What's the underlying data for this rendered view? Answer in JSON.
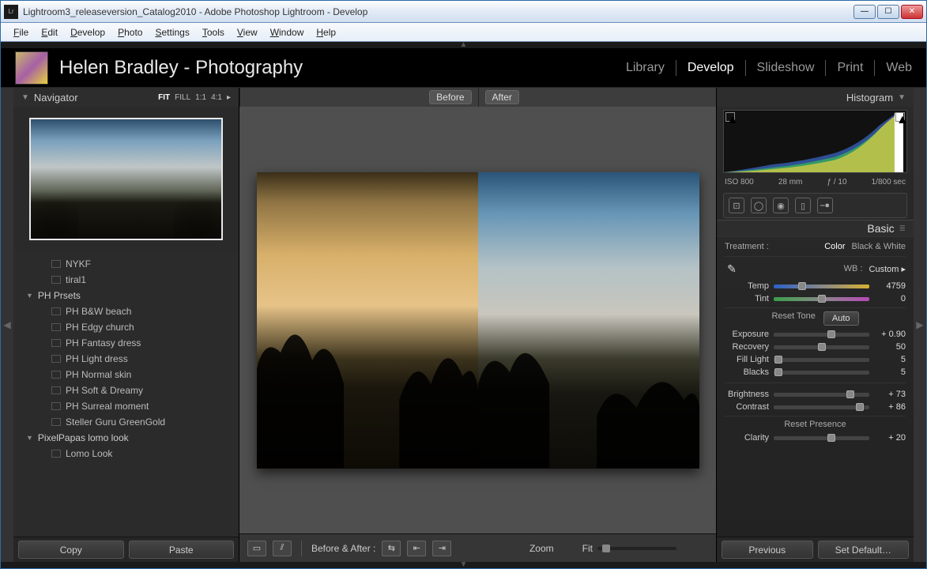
{
  "window": {
    "title": "Lightroom3_releaseversion_Catalog2010 - Adobe Photoshop Lightroom - Develop",
    "app_icon_label": "Lr"
  },
  "menu": [
    "File",
    "Edit",
    "Develop",
    "Photo",
    "Settings",
    "Tools",
    "View",
    "Window",
    "Help"
  ],
  "identity": {
    "name": "Helen Bradley - Photography"
  },
  "modules": [
    "Library",
    "Develop",
    "Slideshow",
    "Print",
    "Web"
  ],
  "active_module": "Develop",
  "navigator": {
    "title": "Navigator",
    "zooms": [
      "FIT",
      "FILL",
      "1:1",
      "4:1"
    ],
    "active_zoom": "FIT"
  },
  "presets": {
    "loose_items": [
      "NYKF",
      "tiral1"
    ],
    "folders": [
      {
        "name": "PH Prsets",
        "items": [
          "PH B&W beach",
          "PH Edgy church",
          "PH Fantasy dress",
          "PH Light dress",
          "PH Normal skin",
          "PH Soft & Dreamy",
          "PH Surreal moment",
          "Steller Guru GreenGold"
        ]
      },
      {
        "name": "PixelPapas lomo look",
        "items": [
          "Lomo Look"
        ]
      }
    ]
  },
  "left_buttons": {
    "copy": "Copy",
    "paste": "Paste"
  },
  "compare": {
    "before": "Before",
    "after": "After"
  },
  "center_footer": {
    "before_after": "Before & After :",
    "zoom": "Zoom",
    "fit": "Fit"
  },
  "histogram": {
    "title": "Histogram",
    "iso": "ISO 800",
    "focal": "28 mm",
    "aperture": "ƒ / 10",
    "shutter": "1/800 sec"
  },
  "basic": {
    "title": "Basic",
    "treatment_label": "Treatment :",
    "color": "Color",
    "bw": "Black & White",
    "wb_label": "WB :",
    "wb_value": "Custom",
    "temp_label": "Temp",
    "temp_value": "4759",
    "tint_label": "Tint",
    "tint_value": "0",
    "reset_tone": "Reset Tone",
    "auto": "Auto",
    "exposure_label": "Exposure",
    "exposure_value": "+ 0.90",
    "recovery_label": "Recovery",
    "recovery_value": "50",
    "fill_label": "Fill Light",
    "fill_value": "5",
    "blacks_label": "Blacks",
    "blacks_value": "5",
    "brightness_label": "Brightness",
    "brightness_value": "+ 73",
    "contrast_label": "Contrast",
    "contrast_value": "+ 86",
    "reset_presence": "Reset Presence",
    "clarity_label": "Clarity",
    "clarity_value": "+ 20"
  },
  "right_buttons": {
    "previous": "Previous",
    "set_default": "Set Default…"
  }
}
